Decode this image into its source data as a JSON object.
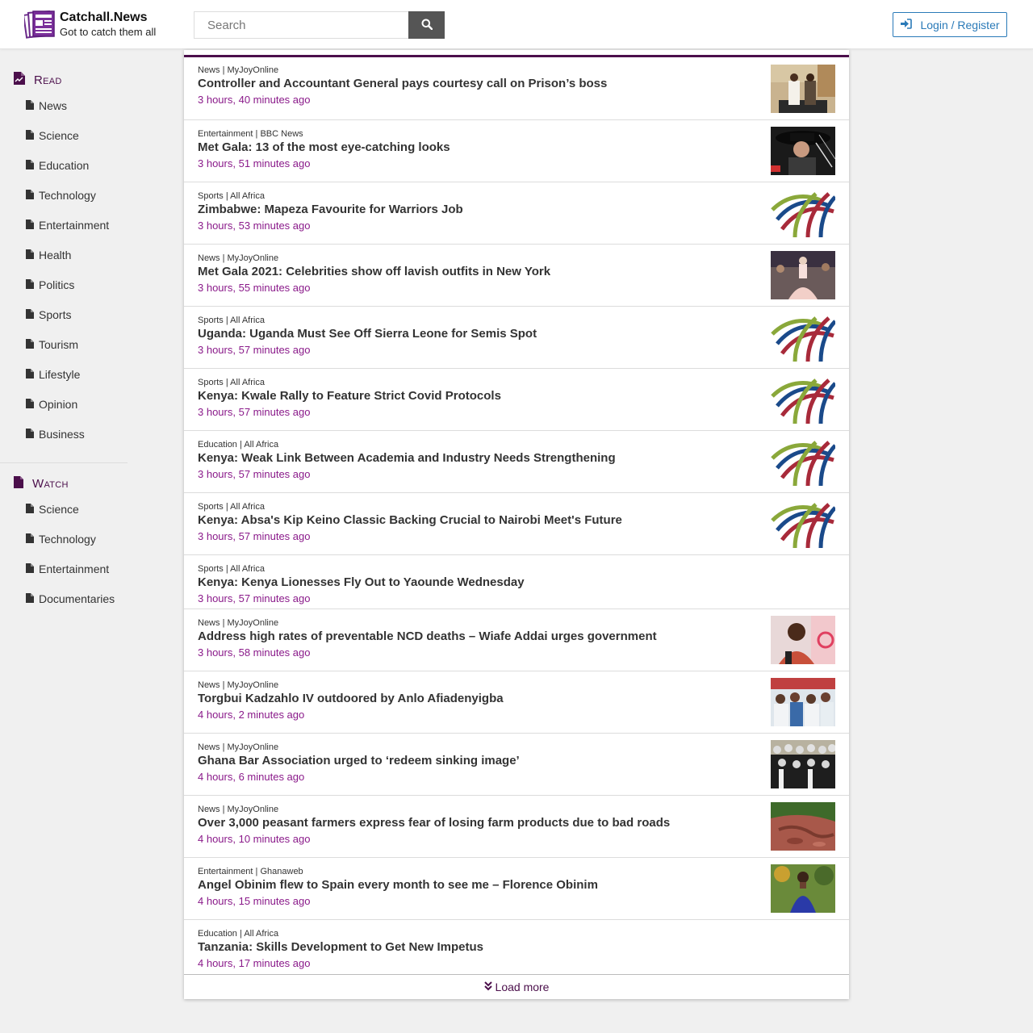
{
  "brand": {
    "name": "Catchall.News",
    "tagline": "Got to catch them all"
  },
  "search": {
    "placeholder": "Search"
  },
  "auth": {
    "login_label": "Login / Register"
  },
  "sidebar": {
    "read": {
      "heading": "Read",
      "items": [
        "News",
        "Science",
        "Education",
        "Technology",
        "Entertainment",
        "Health",
        "Politics",
        "Sports",
        "Tourism",
        "Lifestyle",
        "Opinion",
        "Business"
      ]
    },
    "watch": {
      "heading": "Watch",
      "items": [
        "Science",
        "Technology",
        "Entertainment",
        "Documentaries"
      ]
    }
  },
  "articles": [
    {
      "category": "News",
      "source": "MyJoyOnline",
      "title": "Controller and Accountant General pays courtesy call on Prison’s boss",
      "time": "3 hours, 40 minutes ago",
      "thumb": "photo-office"
    },
    {
      "category": "Entertainment",
      "source": "BBC News",
      "title": "Met Gala: 13 of the most eye-catching looks",
      "time": "3 hours, 51 minutes ago",
      "thumb": "photo-hat"
    },
    {
      "category": "Sports",
      "source": "All Africa",
      "title": "Zimbabwe: Mapeza Favourite for Warriors Job",
      "time": "3 hours, 53 minutes ago",
      "thumb": "allafrica-logo"
    },
    {
      "category": "News",
      "source": "MyJoyOnline",
      "title": "Met Gala 2021: Celebrities show off lavish outfits in New York",
      "time": "3 hours, 55 minutes ago",
      "thumb": "photo-gown"
    },
    {
      "category": "Sports",
      "source": "All Africa",
      "title": "Uganda: Uganda Must See Off Sierra Leone for Semis Spot",
      "time": "3 hours, 57 minutes ago",
      "thumb": "allafrica-logo"
    },
    {
      "category": "Sports",
      "source": "All Africa",
      "title": "Kenya: Kwale Rally to Feature Strict Covid Protocols",
      "time": "3 hours, 57 minutes ago",
      "thumb": "allafrica-logo"
    },
    {
      "category": "Education",
      "source": "All Africa",
      "title": "Kenya: Weak Link Between Academia and Industry Needs Strengthening",
      "time": "3 hours, 57 minutes ago",
      "thumb": "allafrica-logo"
    },
    {
      "category": "Sports",
      "source": "All Africa",
      "title": "Kenya: Absa's Kip Keino Classic Backing Crucial to Nairobi Meet's Future",
      "time": "3 hours, 57 minutes ago",
      "thumb": "allafrica-logo"
    },
    {
      "category": "Sports",
      "source": "All Africa",
      "title": "Kenya: Kenya Lionesses Fly Out to Yaounde Wednesday",
      "time": "3 hours, 57 minutes ago",
      "thumb": ""
    },
    {
      "category": "News",
      "source": "MyJoyOnline",
      "title": "Address high rates of preventable NCD deaths – Wiafe Addai urges government",
      "time": "3 hours, 58 minutes ago",
      "thumb": "photo-speaker"
    },
    {
      "category": "News",
      "source": "MyJoyOnline",
      "title": "Torgbui Kadzahlo IV outdoored by Anlo Afiadenyigba",
      "time": "4 hours, 2 minutes ago",
      "thumb": "photo-crowd-white"
    },
    {
      "category": "News",
      "source": "MyJoyOnline",
      "title": "Ghana Bar Association urged to ‘redeem sinking image’",
      "time": "4 hours, 6 minutes ago",
      "thumb": "photo-lawyers"
    },
    {
      "category": "News",
      "source": "MyJoyOnline",
      "title": "Over 3,000 peasant farmers express fear of losing farm products due to bad roads",
      "time": "4 hours, 10 minutes ago",
      "thumb": "photo-road"
    },
    {
      "category": "Entertainment",
      "source": "Ghanaweb",
      "title": "Angel Obinim flew to Spain every month to see me – Florence Obinim",
      "time": "4 hours, 15 minutes ago",
      "thumb": "photo-blue-dress"
    },
    {
      "category": "Education",
      "source": "All Africa",
      "title": "Tanzania: Skills Development to Get New Impetus",
      "time": "4 hours, 17 minutes ago",
      "thumb": ""
    }
  ],
  "load_more": {
    "label": "Load more"
  },
  "colors": {
    "accent": "#4b0f4b",
    "time": "#8a1a8a",
    "login": "#2a7ab8",
    "search_button": "#555555"
  }
}
